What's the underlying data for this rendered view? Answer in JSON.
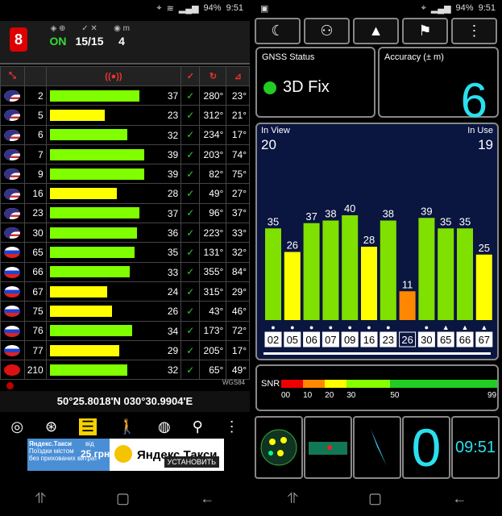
{
  "left_status": {
    "battery": "94%",
    "time": "9:51"
  },
  "right_status": {
    "battery": "94%",
    "time": "9:51"
  },
  "topbar": {
    "logo": "8",
    "fix": "ON",
    "in_use_in_view": "15/15",
    "count_label": "m",
    "count": "4"
  },
  "satellites": [
    {
      "flag": "us",
      "prn": "2",
      "snr": 37,
      "used": true,
      "az": "280°",
      "el": "23°",
      "color": "#80ff00"
    },
    {
      "flag": "us",
      "prn": "5",
      "snr": 23,
      "used": true,
      "az": "312°",
      "el": "21°",
      "color": "#ffff00"
    },
    {
      "flag": "us",
      "prn": "6",
      "snr": 32,
      "used": true,
      "az": "234°",
      "el": "17°",
      "color": "#80ff00"
    },
    {
      "flag": "us",
      "prn": "7",
      "snr": 39,
      "used": true,
      "az": "203°",
      "el": "74°",
      "color": "#80ff00"
    },
    {
      "flag": "us",
      "prn": "9",
      "snr": 39,
      "used": true,
      "az": "82°",
      "el": "75°",
      "color": "#80ff00"
    },
    {
      "flag": "us",
      "prn": "16",
      "snr": 28,
      "used": true,
      "az": "49°",
      "el": "27°",
      "color": "#ffff00"
    },
    {
      "flag": "us",
      "prn": "23",
      "snr": 37,
      "used": true,
      "az": "96°",
      "el": "37°",
      "color": "#80ff00"
    },
    {
      "flag": "us",
      "prn": "30",
      "snr": 36,
      "used": true,
      "az": "223°",
      "el": "33°",
      "color": "#80ff00"
    },
    {
      "flag": "ru",
      "prn": "65",
      "snr": 35,
      "used": true,
      "az": "131°",
      "el": "32°",
      "color": "#80ff00"
    },
    {
      "flag": "ru",
      "prn": "66",
      "snr": 33,
      "used": true,
      "az": "355°",
      "el": "84°",
      "color": "#80ff00"
    },
    {
      "flag": "ru",
      "prn": "67",
      "snr": 24,
      "used": true,
      "az": "315°",
      "el": "29°",
      "color": "#ffff00"
    },
    {
      "flag": "ru",
      "prn": "75",
      "snr": 26,
      "used": true,
      "az": "43°",
      "el": "46°",
      "color": "#ffff00"
    },
    {
      "flag": "ru",
      "prn": "76",
      "snr": 34,
      "used": true,
      "az": "173°",
      "el": "72°",
      "color": "#80ff00"
    },
    {
      "flag": "ru",
      "prn": "77",
      "snr": 29,
      "used": true,
      "az": "205°",
      "el": "17°",
      "color": "#ffff00"
    },
    {
      "flag": "cn",
      "prn": "210",
      "snr": 32,
      "used": true,
      "az": "65°",
      "el": "49°",
      "color": "#80ff00"
    }
  ],
  "datum": "WGS84",
  "coords": "50°25.8018'N   030°30.9904'E",
  "ad": {
    "title": "Яндекс.Такси",
    "sub1": "Поїздки містом",
    "sub2": "без прихованих витрат",
    "price_prefix": "від",
    "price": "25 грн",
    "brand": "Яндекс.Такси",
    "install": "УСТАНОВИТЬ"
  },
  "gnss": {
    "label": "GNSS Status",
    "fix": "3D Fix",
    "acc_label": "Accuracy (± m)",
    "accuracy": "6"
  },
  "chart_data": {
    "type": "bar",
    "in_view_label": "In View",
    "in_view": "20",
    "in_use_label": "In Use",
    "in_use": "19",
    "categories": [
      "02",
      "05",
      "06",
      "07",
      "09",
      "16",
      "23",
      "26",
      "30",
      "65",
      "66",
      "67"
    ],
    "values": [
      35,
      26,
      37,
      38,
      40,
      28,
      38,
      11,
      39,
      35,
      35,
      25
    ],
    "colors": [
      "#80e000",
      "#ffff00",
      "#80e000",
      "#80e000",
      "#80e000",
      "#ffff00",
      "#80e000",
      "#ff8800",
      "#80e000",
      "#80e000",
      "#80e000",
      "#ffff00"
    ],
    "markers": [
      "●",
      "●",
      "●",
      "●",
      "●",
      "●",
      "●",
      "",
      "●",
      "▲",
      "▲",
      "▲"
    ]
  },
  "snr": {
    "label": "SNR",
    "ticks": [
      "00",
      "10",
      "20",
      "30",
      "50",
      "99"
    ]
  },
  "speed": "0",
  "clock": "09:51"
}
